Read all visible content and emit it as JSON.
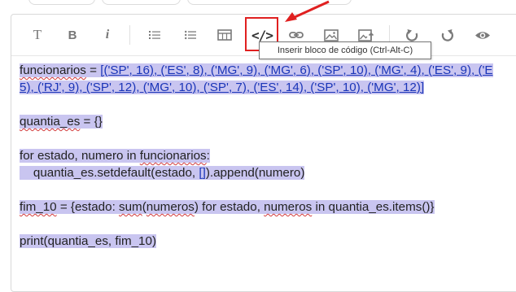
{
  "toolbar": {
    "text_label": "T",
    "bold_label": "B",
    "italic_label": "i",
    "code_label": "</>",
    "tooltip": "Inserir bloco de código (Ctrl-Alt-C)"
  },
  "highlight_color": "#e02020",
  "selection_color": "#c9c5f0",
  "code": {
    "line1": "funcionarios = [('SP', 16), ('ES', 8), ('MG', 9), ('MG', 6), ('SP', 10), ('MG', 4), ('ES', 9), ('E",
    "line2": "5), ('RJ', 9), ('SP', 12), ('MG', 10), ('SP', 7), ('ES', 14), ('SP', 10), ('MG', 12)]",
    "line3": "quantia_es = {}",
    "line4": "for estado, numero in funcionarios:",
    "line5": "    quantia_es.setdefault(estado, []).append(numero)",
    "line6": "fim_10 = {estado: sum(numeros) for estado, numeros in quantia_es.items()}",
    "line7": "print(quantia_es, fim_10)"
  }
}
